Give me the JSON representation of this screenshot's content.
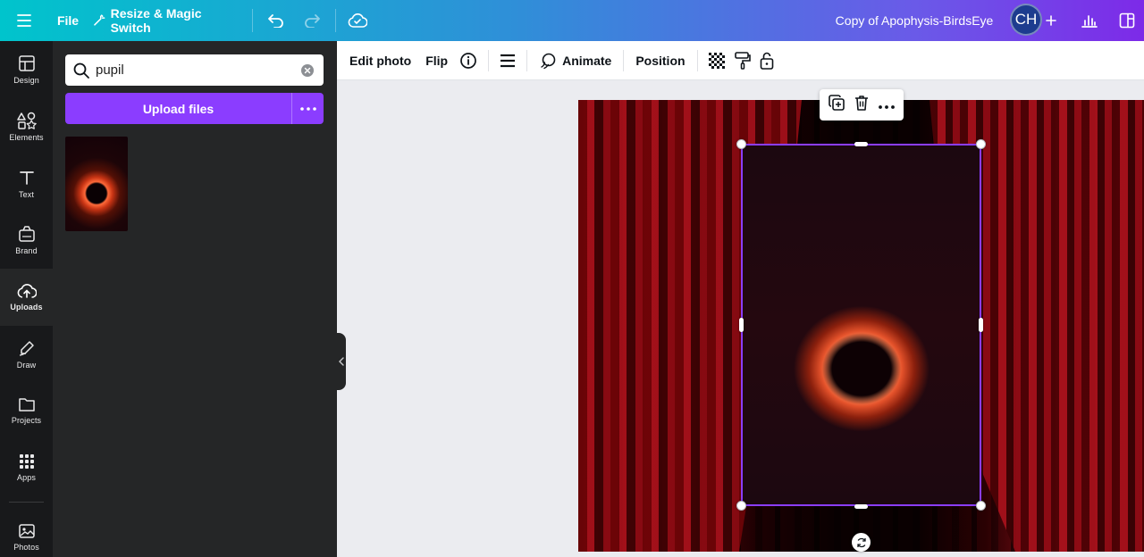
{
  "topbar": {
    "file_label": "File",
    "resize_label": "Resize & Magic Switch",
    "doc_title": "Copy of Apophysis-BirdsEye",
    "avatar_initials": "CH"
  },
  "rail": {
    "items": [
      {
        "label": "Design",
        "icon": "layout-icon"
      },
      {
        "label": "Elements",
        "icon": "shapes-icon"
      },
      {
        "label": "Text",
        "icon": "text-icon"
      },
      {
        "label": "Brand",
        "icon": "brand-icon"
      },
      {
        "label": "Uploads",
        "icon": "cloud-upload-icon",
        "active": true
      },
      {
        "label": "Draw",
        "icon": "pen-icon"
      },
      {
        "label": "Projects",
        "icon": "folder-icon"
      },
      {
        "label": "Apps",
        "icon": "grid-icon"
      },
      {
        "label": "Photos",
        "icon": "image-icon"
      }
    ]
  },
  "panel": {
    "search_value": "pupil",
    "upload_label": "Upload files"
  },
  "toolbar": {
    "edit_photo": "Edit photo",
    "flip": "Flip",
    "animate": "Animate",
    "position": "Position"
  },
  "colors": {
    "accent": "#8b3dff",
    "panel_bg": "#252627",
    "rail_bg": "#18191b"
  }
}
